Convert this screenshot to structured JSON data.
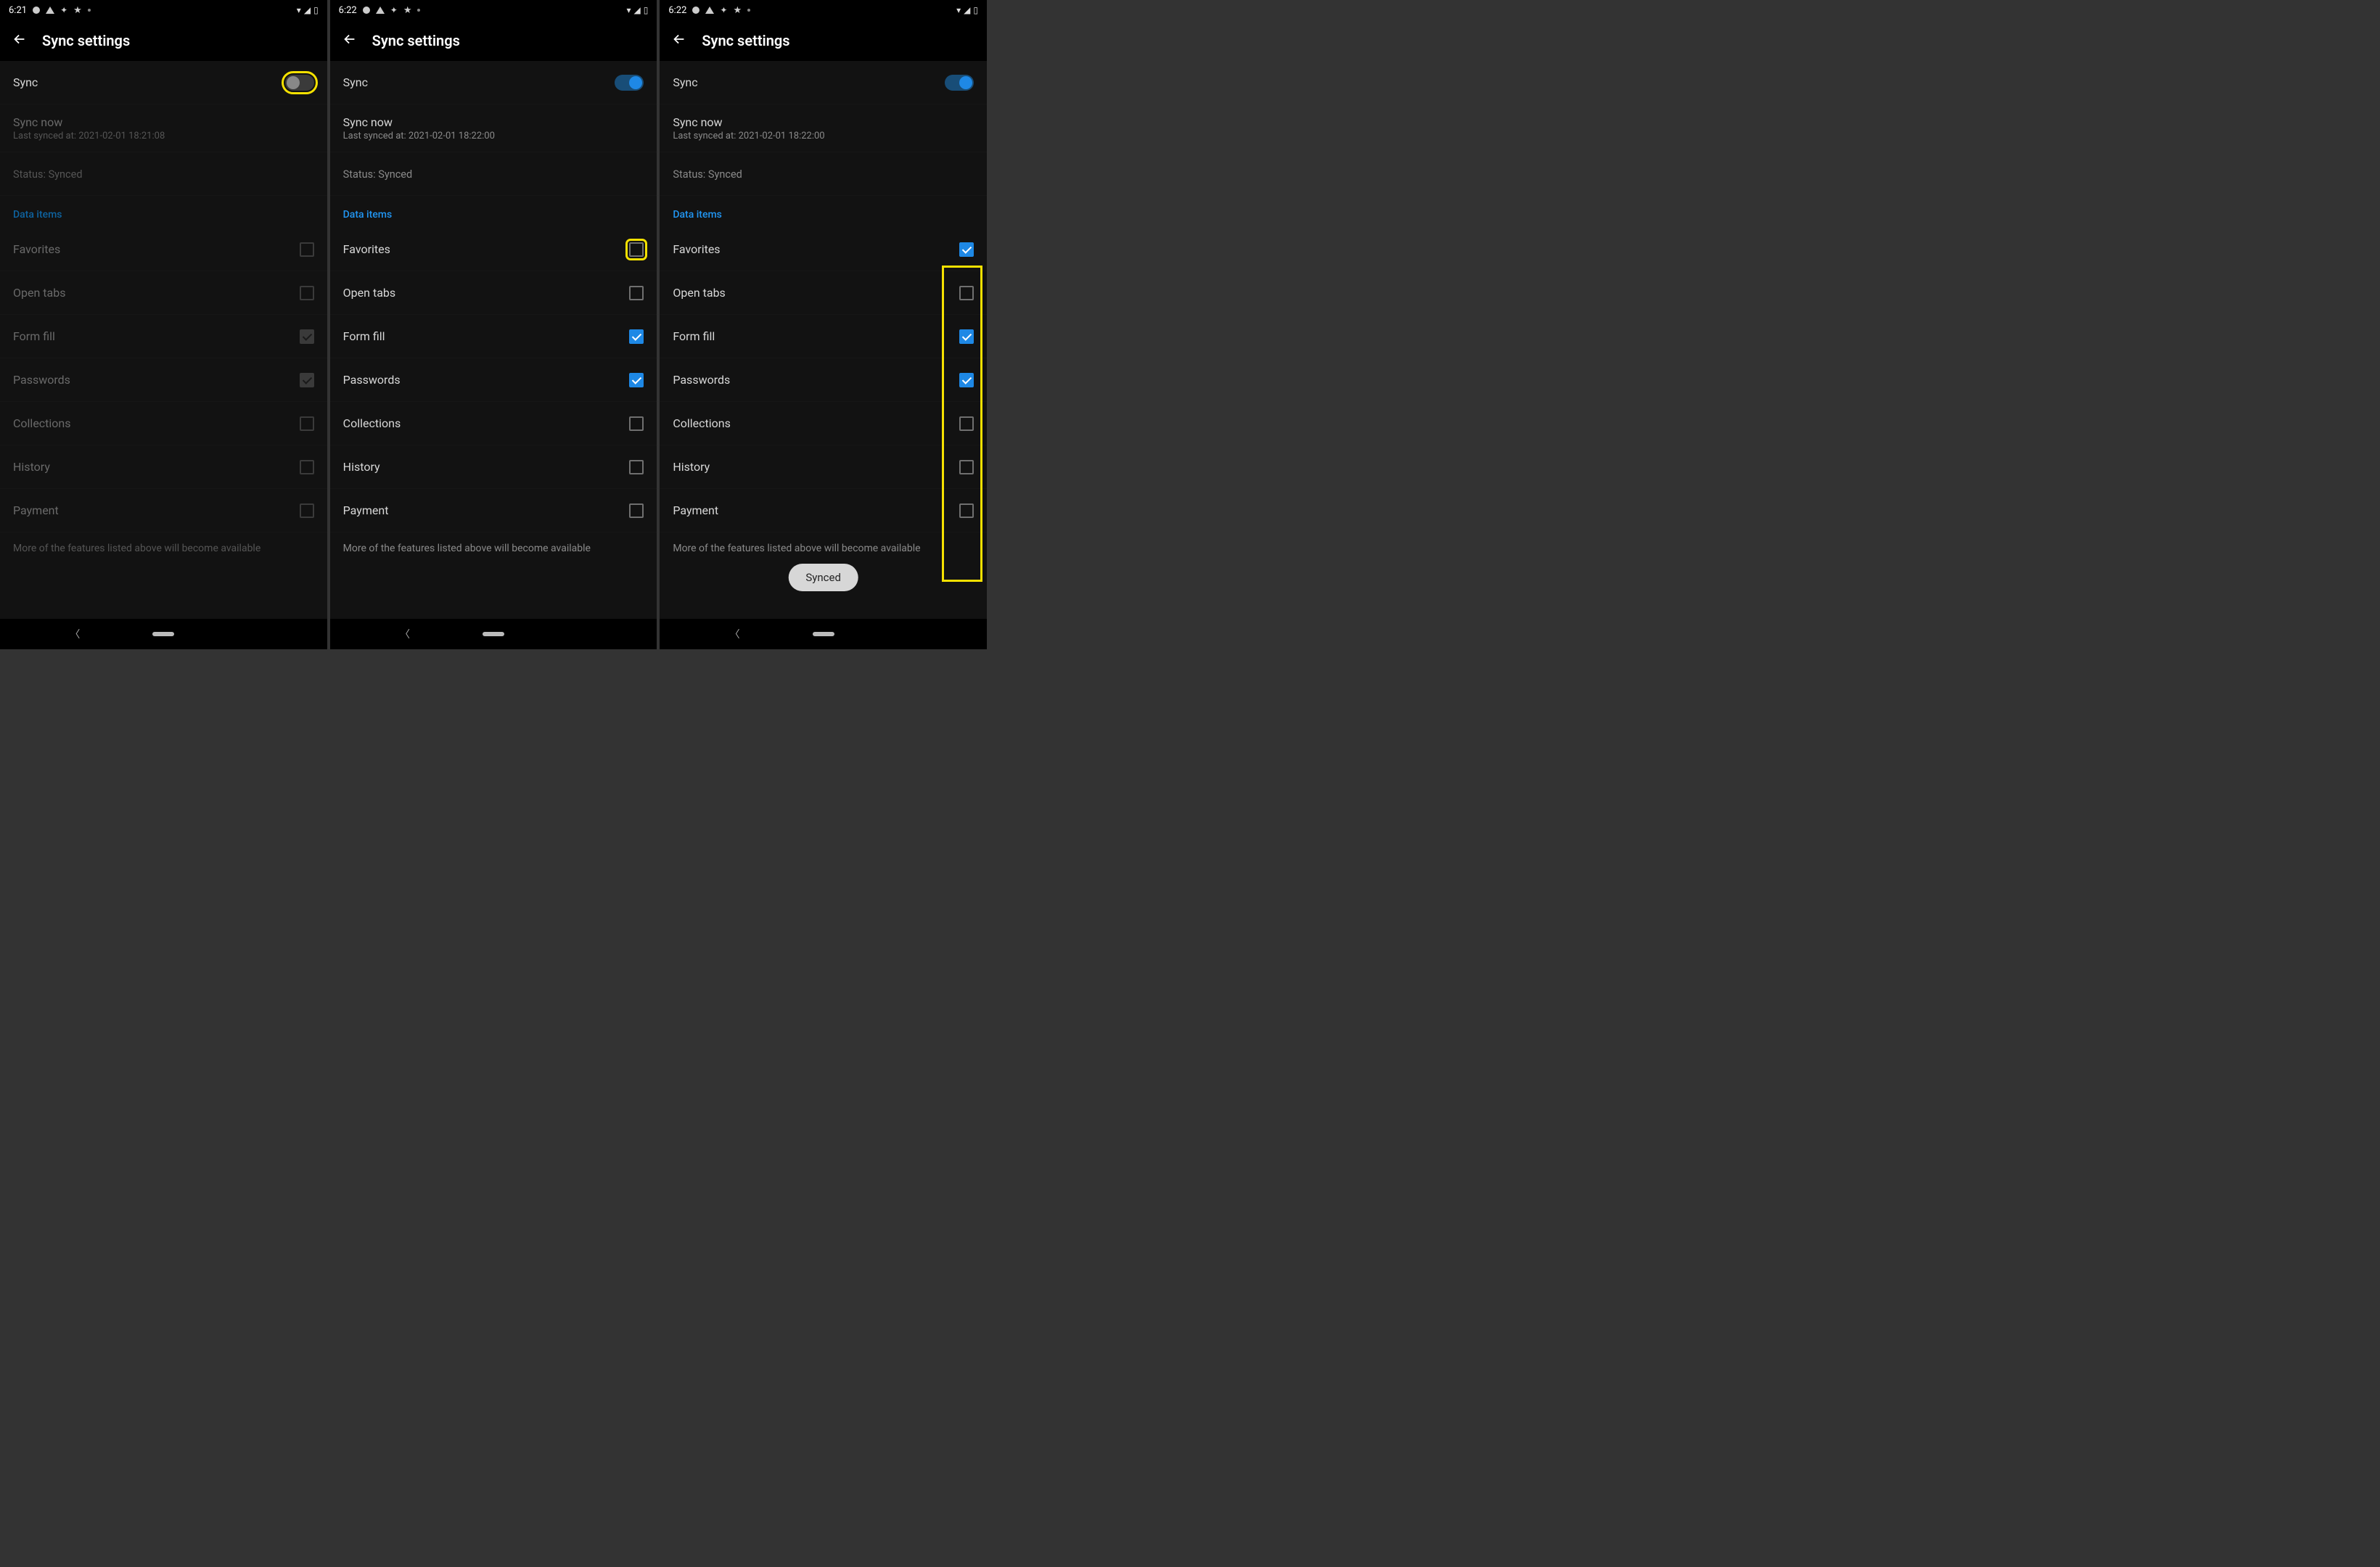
{
  "screens": [
    {
      "time": "6:21",
      "title": "Sync settings",
      "sync_label": "Sync",
      "sync_on": false,
      "disabled": true,
      "highlight_toggle": true,
      "highlight_fav_checkbox": false,
      "highlight_checkbox_column": false,
      "sync_now_label": "Sync now",
      "last_synced": "Last synced at: 2021-02-01 18:21:08",
      "status_label": "Status: Synced",
      "section_label": "Data items",
      "items": [
        {
          "label": "Favorites",
          "checked": false
        },
        {
          "label": "Open tabs",
          "checked": false
        },
        {
          "label": "Form fill",
          "checked": true
        },
        {
          "label": "Passwords",
          "checked": true
        },
        {
          "label": "Collections",
          "checked": false
        },
        {
          "label": "History",
          "checked": false
        },
        {
          "label": "Payment",
          "checked": false
        }
      ],
      "footnote": "More of the features listed above will become available",
      "toast": null
    },
    {
      "time": "6:22",
      "title": "Sync settings",
      "sync_label": "Sync",
      "sync_on": true,
      "disabled": false,
      "highlight_toggle": false,
      "highlight_fav_checkbox": true,
      "highlight_checkbox_column": false,
      "sync_now_label": "Sync now",
      "last_synced": "Last synced at: 2021-02-01 18:22:00",
      "status_label": "Status: Synced",
      "section_label": "Data items",
      "items": [
        {
          "label": "Favorites",
          "checked": false
        },
        {
          "label": "Open tabs",
          "checked": false
        },
        {
          "label": "Form fill",
          "checked": true
        },
        {
          "label": "Passwords",
          "checked": true
        },
        {
          "label": "Collections",
          "checked": false
        },
        {
          "label": "History",
          "checked": false
        },
        {
          "label": "Payment",
          "checked": false
        }
      ],
      "footnote": "More of the features listed above will become available",
      "toast": null
    },
    {
      "time": "6:22",
      "title": "Sync settings",
      "sync_label": "Sync",
      "sync_on": true,
      "disabled": false,
      "highlight_toggle": false,
      "highlight_fav_checkbox": false,
      "highlight_checkbox_column": true,
      "sync_now_label": "Sync now",
      "last_synced": "Last synced at: 2021-02-01 18:22:00",
      "status_label": "Status: Synced",
      "section_label": "Data items",
      "items": [
        {
          "label": "Favorites",
          "checked": true
        },
        {
          "label": "Open tabs",
          "checked": false
        },
        {
          "label": "Form fill",
          "checked": true
        },
        {
          "label": "Passwords",
          "checked": true
        },
        {
          "label": "Collections",
          "checked": false
        },
        {
          "label": "History",
          "checked": false
        },
        {
          "label": "Payment",
          "checked": false
        }
      ],
      "footnote": "More of the features listed above will become available",
      "toast": "Synced"
    }
  ]
}
